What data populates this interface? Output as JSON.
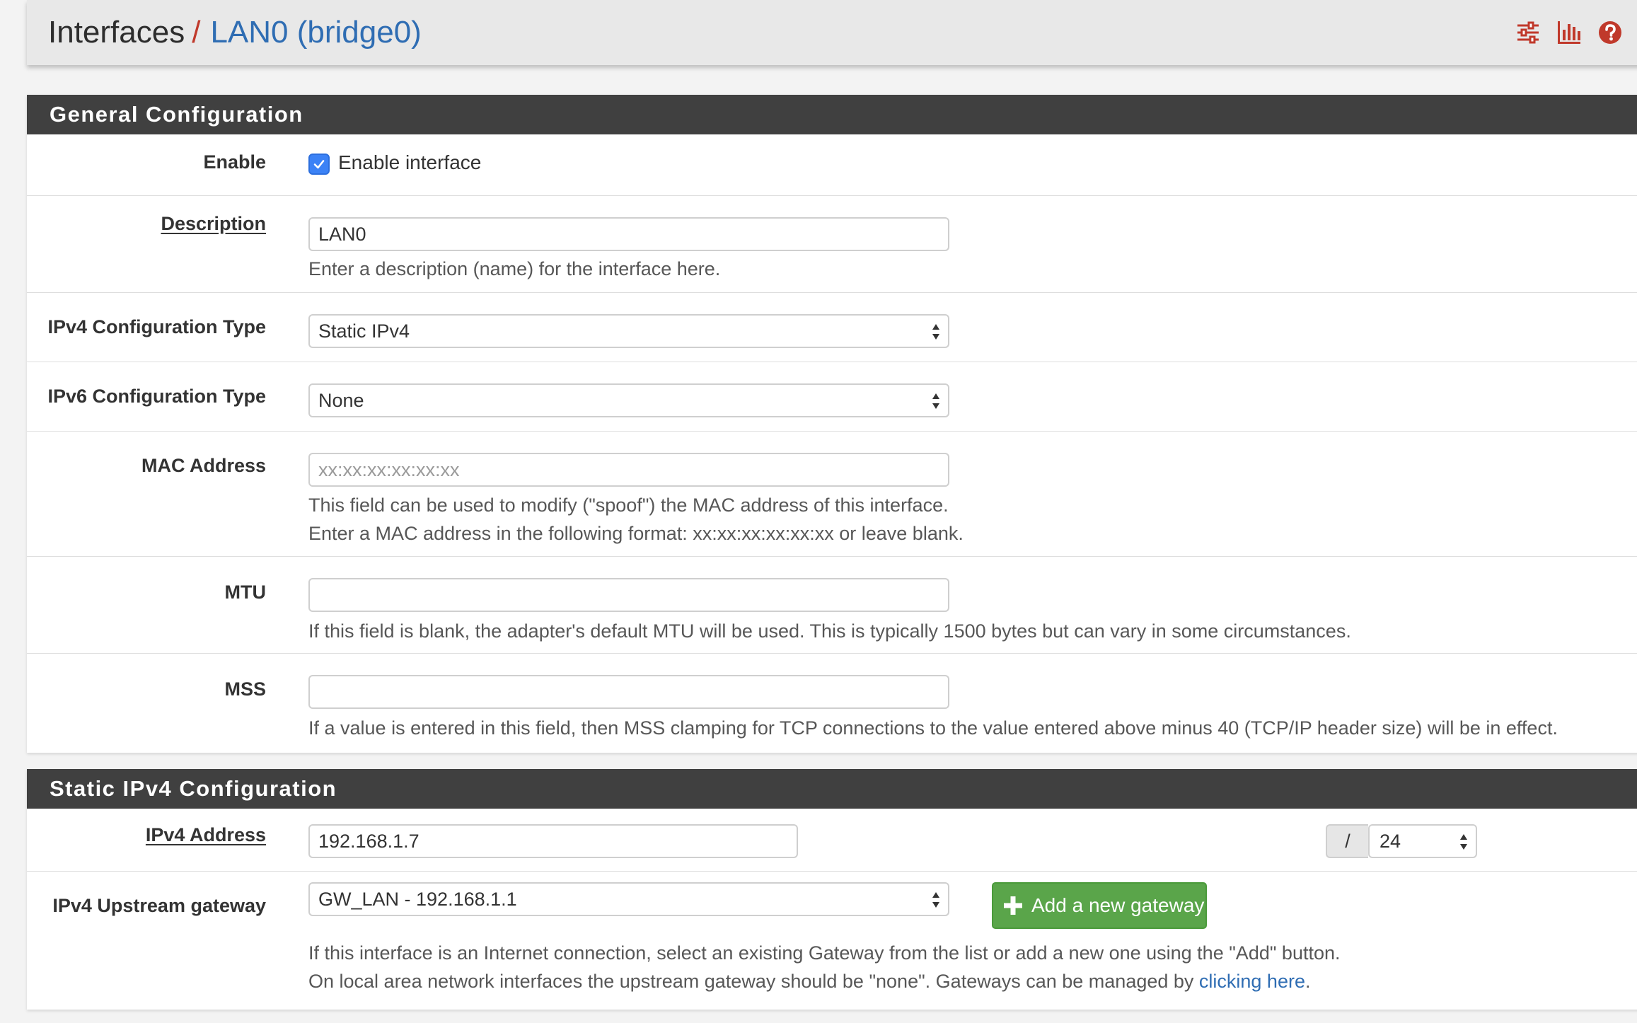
{
  "header": {
    "breadcrumb_parent": "Interfaces",
    "breadcrumb_separator": "/",
    "breadcrumb_current": "LAN0 (bridge0)",
    "icons": [
      "sliders-icon",
      "bar-chart-icon",
      "help-icon"
    ],
    "accent_color": "#c0392b",
    "link_color": "#2f6db3"
  },
  "general": {
    "heading": "General Configuration",
    "enable": {
      "label": "Enable",
      "checkbox_label": "Enable interface",
      "checked": true
    },
    "description": {
      "label": "Description",
      "value": "LAN0",
      "help": "Enter a description (name) for the interface here."
    },
    "ipv4_type": {
      "label": "IPv4 Configuration Type",
      "selected": "Static IPv4"
    },
    "ipv6_type": {
      "label": "IPv6 Configuration Type",
      "selected": "None"
    },
    "mac": {
      "label": "MAC Address",
      "placeholder": "xx:xx:xx:xx:xx:xx",
      "help_line1": "This field can be used to modify (\"spoof\") the MAC address of this interface.",
      "help_line2": "Enter a MAC address in the following format: xx:xx:xx:xx:xx:xx or leave blank."
    },
    "mtu": {
      "label": "MTU",
      "value": "",
      "help": "If this field is blank, the adapter's default MTU will be used. This is typically 1500 bytes but can vary in some circumstances."
    },
    "mss": {
      "label": "MSS",
      "value": "",
      "help": "If a value is entered in this field, then MSS clamping for TCP connections to the value entered above minus 40 (TCP/IP header size) will be in effect."
    }
  },
  "static": {
    "heading": "Static IPv4 Configuration",
    "ipv4_address": {
      "label": "IPv4 Address",
      "value": "192.168.1.7",
      "slash": "/",
      "cidr": "24"
    },
    "gateway": {
      "label": "IPv4 Upstream gateway",
      "selected": "GW_LAN - 192.168.1.1",
      "add_button": "Add a new gateway",
      "help_line1": "If this interface is an Internet connection, select an existing Gateway from the list or add a new one using the \"Add\" button.",
      "help_line2_prefix": "On local area network interfaces the upstream gateway should be \"none\". Gateways can be managed by ",
      "help_link": "clicking here",
      "help_line2_suffix": "."
    },
    "button_color": "#5aa54a"
  }
}
